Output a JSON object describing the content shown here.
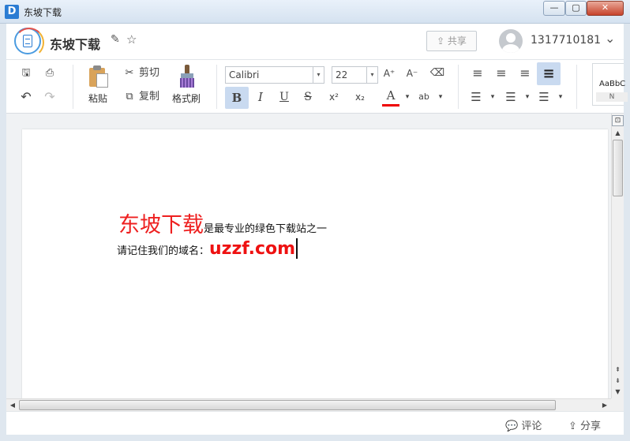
{
  "window": {
    "app_icon_letter": "D",
    "title": "东坡下载",
    "min_glyph": "—",
    "max_glyph": "▢",
    "close_glyph": "✕"
  },
  "header": {
    "doc_title": "东坡下载",
    "edit_icon": "✎",
    "star_icon": "☆",
    "share_label": "⇪ 共享",
    "user_name": "1317710181",
    "caret": "⌄"
  },
  "toolbar": {
    "save_icon": "🖫",
    "print_icon": "⎙",
    "undo_icon": "↶",
    "redo_icon": "↷",
    "paste_label": "粘贴",
    "cut_icon": "✂",
    "cut_label": "剪切",
    "copy_icon": "⧉",
    "copy_label": "复制",
    "format_painter_label": "格式刷",
    "font_name": "Calibri",
    "font_size": "22",
    "grow_font": "A⁺",
    "shrink_font": "A⁻",
    "clear_format": "⌫",
    "bold": "B",
    "italic": "I",
    "underline": "U",
    "strike": "S",
    "superscript": "x²",
    "subscript": "x₂",
    "font_color": "A",
    "highlight": "ab",
    "dropdown": "▾",
    "align_left": "≡",
    "align_center": "≡",
    "align_right": "≡",
    "align_justify": "≡",
    "numbered_list": "☰",
    "bullet_list": "☰",
    "line_spacing": "☰",
    "style_sample": "AaBbC",
    "style_name": "N"
  },
  "document": {
    "line1_big": "东坡下载",
    "line1_rest": "是最专业的绿色下载站之一",
    "line2_label": "请记住我们的域名：",
    "line2_domain": "uzzf.com"
  },
  "scroll": {
    "up": "▲",
    "down": "▼",
    "page_up": "⇞",
    "page_down": "⇟",
    "left": "◀",
    "right": "▶",
    "top_btn": "⊡"
  },
  "bottom": {
    "comment_label": "💬 评论",
    "share_label": "⇪ 分享"
  },
  "colors": {
    "brand_blue": "#2b7cd3",
    "headline_red": "#ee2020",
    "active_button": "#c9daf0"
  }
}
